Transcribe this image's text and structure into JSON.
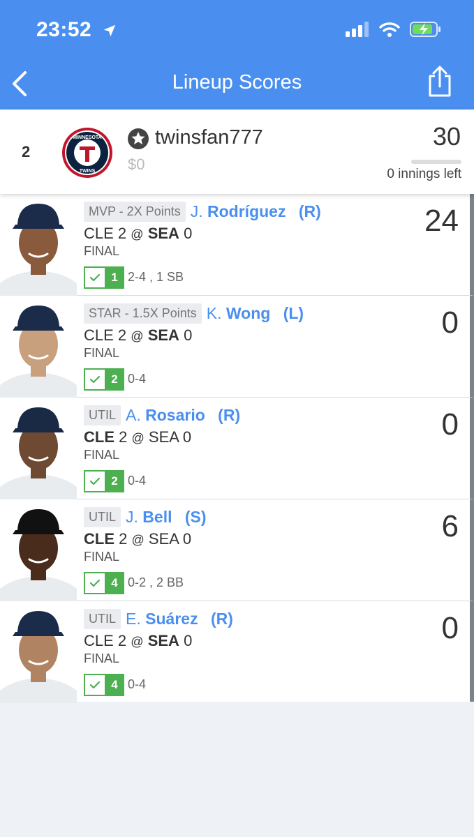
{
  "status_bar": {
    "time": "23:52"
  },
  "header": {
    "title": "Lineup Scores"
  },
  "summary": {
    "rank": "2",
    "team_logo_text_top": "MINNESOTA",
    "team_logo_text_bottom": "TWINS",
    "username": "twinsfan777",
    "prize": "$0",
    "total_score": "30",
    "innings_left": "0 innings left"
  },
  "players": [
    {
      "slot": "MVP - 2X Points",
      "initial": "J.",
      "last": "Rodríguez",
      "hand": "(R)",
      "away": "CLE",
      "away_score": "2",
      "at": "@",
      "home": "SEA",
      "home_score": "0",
      "bold": "home",
      "status": "FINAL",
      "order": "1",
      "stats": "2-4 , 1 SB",
      "points": "24",
      "cap": "#1b2b4a",
      "skin": "#8a5a3c"
    },
    {
      "slot": "STAR - 1.5X Points",
      "initial": "K.",
      "last": "Wong",
      "hand": "(L)",
      "away": "CLE",
      "away_score": "2",
      "at": "@",
      "home": "SEA",
      "home_score": "0",
      "bold": "home",
      "status": "FINAL",
      "order": "2",
      "stats": "0-4",
      "points": "0",
      "cap": "#1b2b4a",
      "skin": "#c9a07e"
    },
    {
      "slot": "UTIL",
      "initial": "A.",
      "last": "Rosario",
      "hand": "(R)",
      "away": "CLE",
      "away_score": "2",
      "at": "@",
      "home": "SEA",
      "home_score": "0",
      "bold": "away",
      "status": "FINAL",
      "order": "2",
      "stats": "0-4",
      "points": "0",
      "cap": "#1a2a45",
      "skin": "#6e4a33"
    },
    {
      "slot": "UTIL",
      "initial": "J.",
      "last": "Bell",
      "hand": "(S)",
      "away": "CLE",
      "away_score": "2",
      "at": "@",
      "home": "SEA",
      "home_score": "0",
      "bold": "away",
      "status": "FINAL",
      "order": "4",
      "stats": "0-2 , 2 BB",
      "points": "6",
      "cap": "#111111",
      "skin": "#4a2c1c"
    },
    {
      "slot": "UTIL",
      "initial": "E.",
      "last": "Suárez",
      "hand": "(R)",
      "away": "CLE",
      "away_score": "2",
      "at": "@",
      "home": "SEA",
      "home_score": "0",
      "bold": "home",
      "status": "FINAL",
      "order": "4",
      "stats": "0-4",
      "points": "0",
      "cap": "#1b2b4a",
      "skin": "#b08463"
    }
  ]
}
